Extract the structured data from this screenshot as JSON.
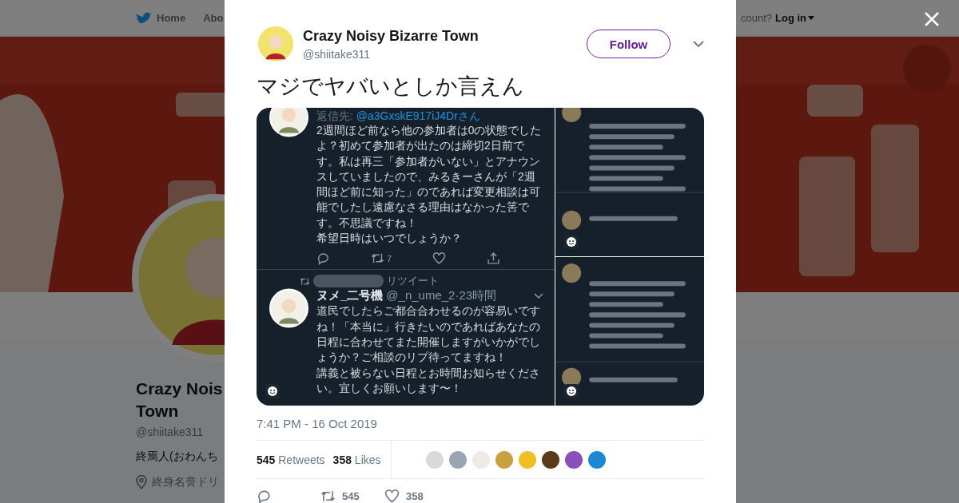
{
  "background_page": {
    "nav": {
      "items": [
        {
          "label": "Home",
          "kind": "home"
        },
        {
          "label": "Abo",
          "kind": "link"
        }
      ],
      "account_prompt": "count?",
      "login": "Log in"
    },
    "profile": {
      "name_lines": [
        "Crazy Nois",
        "Town"
      ],
      "handle": "@shiitake311",
      "bio": "終焉人(おわんち",
      "location": "終身名誉ドリ"
    }
  },
  "tweet_modal": {
    "author": {
      "name": "Crazy Noisy Bizarre Town",
      "handle": "@shiitake311"
    },
    "follow_button": "Follow",
    "text": "マジでヤバいとしか言えん",
    "media": {
      "main": {
        "tweets": [
          {
            "reply_label": "返信先:",
            "reply_handle": "@a3GxskE917iJ4Drさん",
            "paragraphs": [
              "2週間ほど前なら他の参加者は0の状態でしたよ？初めて参加者が出たのは締切2日前です。私は再三「参加者がいない」とアナウンスしていましたので、みるきーさんが「2週間ほど前に知った」のであれば変更相談は可能でしたし遠慮なさる理由はなかった筈です。不思議ですね！",
              "希望日時はいつでしょうか？"
            ],
            "actions": [
              {
                "kind": "reply"
              },
              {
                "kind": "retweet",
                "count": "7"
              },
              {
                "kind": "like"
              },
              {
                "kind": "share"
              }
            ]
          },
          {
            "retweeted_label": "リツイート",
            "name": "ヌメ_二号機",
            "meta": "@_n_ume_2·23時間",
            "paragraphs": [
              "道民でしたらご都合合わせるのが容易いですね！「本当に」行きたいのであればあなたの日程に合わせてまた開催しますがいかがでしょうか？ご相談のリプ待ってますね！",
              "講義と被らない日程とお時間お知らせください。宜しくお願いします〜！"
            ]
          }
        ]
      }
    },
    "timestamp": "7:41 PM - 16 Oct 2019",
    "stats": [
      {
        "count": "545",
        "label": "Retweets"
      },
      {
        "count": "358",
        "label": "Likes"
      }
    ],
    "liker_avatars": [
      {
        "color": "#d9d9d9"
      },
      {
        "color": "#9aa5b1"
      },
      {
        "color": "#eeeae4"
      },
      {
        "color": "#c9a040"
      },
      {
        "color": "#f0c020"
      },
      {
        "color": "#5a3a1a"
      },
      {
        "color": "#8a4fb8"
      },
      {
        "color": "#1a8ad4"
      }
    ],
    "actions": [
      {
        "kind": "reply"
      },
      {
        "kind": "retweet",
        "count": "545"
      },
      {
        "kind": "like",
        "count": "358"
      }
    ]
  }
}
